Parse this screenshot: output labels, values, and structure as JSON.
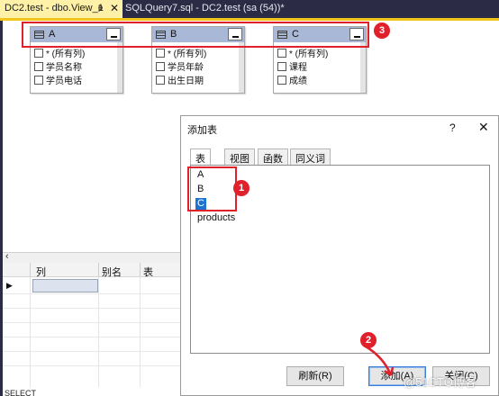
{
  "tabs": {
    "active": "DC2.test - dbo.View_1",
    "active_pin": "ᵽ",
    "active_close": "✕",
    "second": "SQLQuery7.sql - DC2.test (sa (54))*"
  },
  "diagram": {
    "tables": [
      {
        "name": "A",
        "rows": [
          "* (所有列)",
          "学员名称",
          "学员电话"
        ]
      },
      {
        "name": "B",
        "rows": [
          "* (所有列)",
          "学员年龄",
          "出生日期"
        ]
      },
      {
        "name": "C",
        "rows": [
          "* (所有列)",
          "课程",
          "成绩"
        ]
      }
    ]
  },
  "grid": {
    "headers": [
      "列",
      "别名",
      "表"
    ],
    "row_marker": "▶"
  },
  "sql_pane": {
    "text": "SELECT"
  },
  "dialog": {
    "title": "添加表",
    "help": "?",
    "close": "✕",
    "tabs": [
      "表",
      "视图",
      "函数",
      "同义词"
    ],
    "items": [
      "A",
      "B",
      "C",
      "products"
    ],
    "selected_item": "C",
    "refresh_button": "刷新(R)",
    "add_button": "添加(A)",
    "close_button": "关闭(C)"
  },
  "annotations": {
    "badge_1": "1",
    "badge_2": "2",
    "badge_3": "3",
    "color": "#e0212b"
  },
  "watermark": "@51CTO博客"
}
